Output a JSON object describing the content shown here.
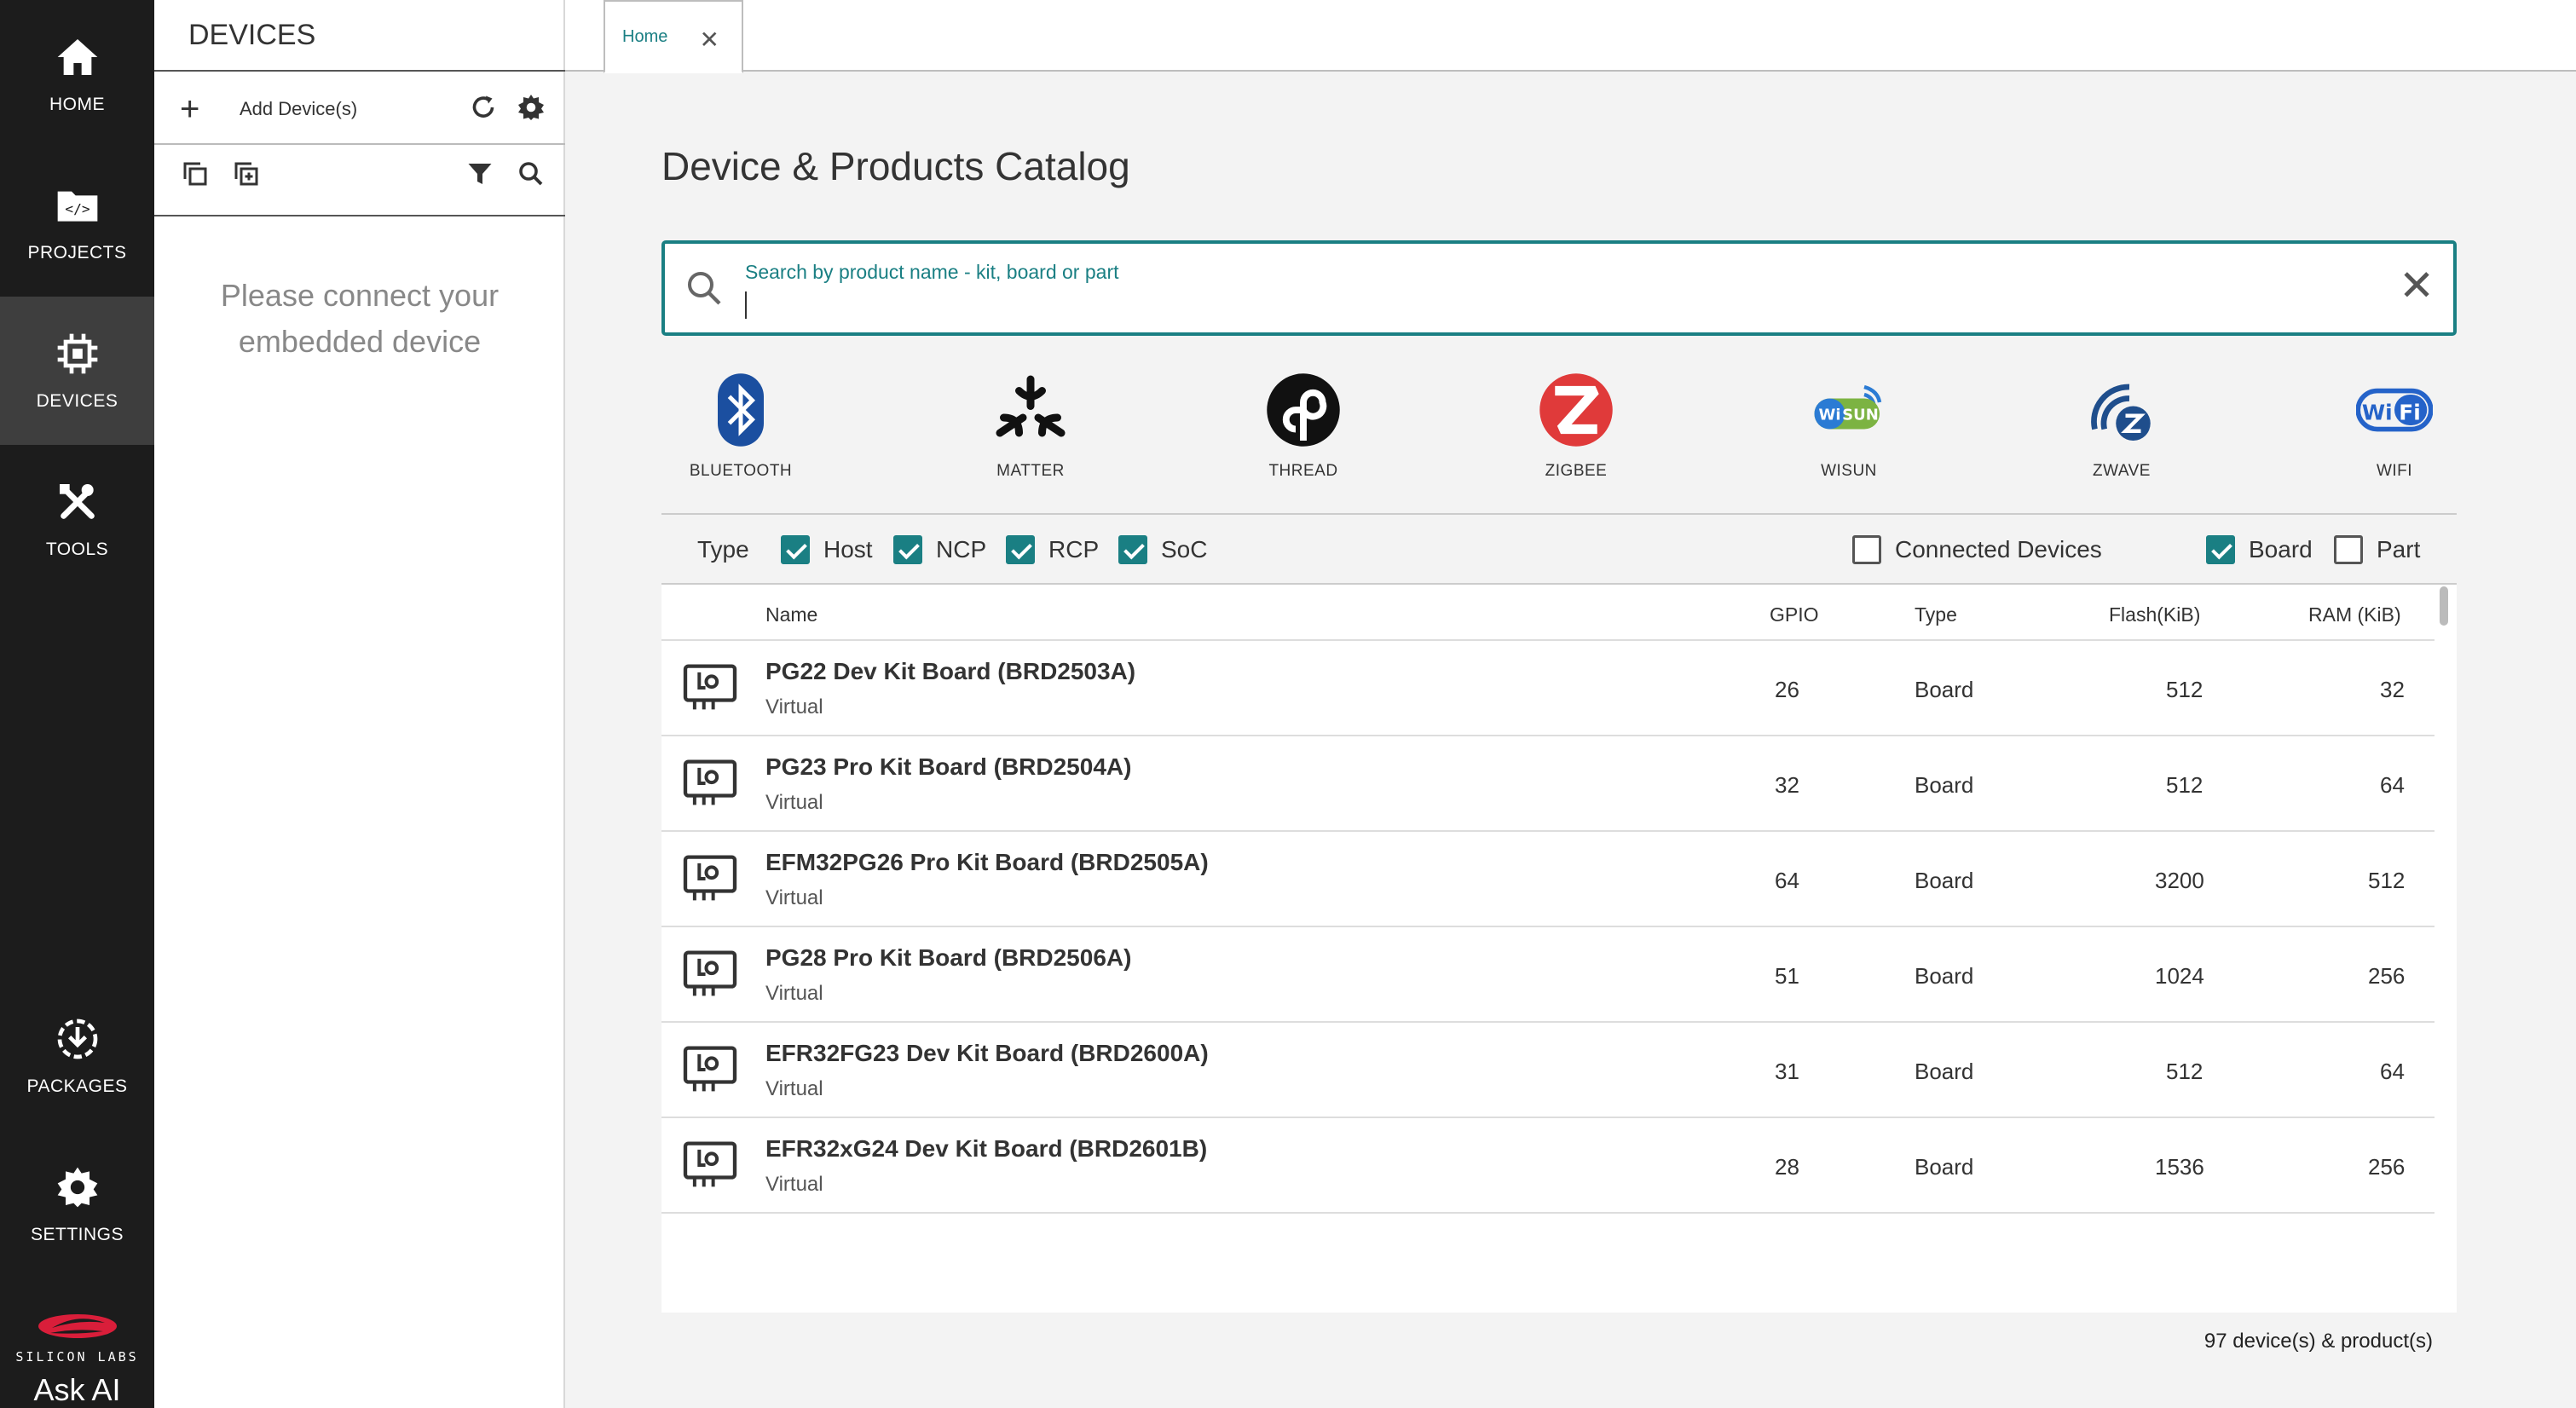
{
  "nav": {
    "home": "HOME",
    "projects": "PROJECTS",
    "devices": "DEVICES",
    "tools": "TOOLS",
    "packages": "PACKAGES",
    "settings": "SETTINGS",
    "logo_text": "SILICON LABS",
    "ask_ai": "Ask AI"
  },
  "devices_panel": {
    "title": "DEVICES",
    "add_label": "Add Device(s)",
    "empty_message": "Please connect your embedded device"
  },
  "tabs": [
    {
      "label": "Home"
    }
  ],
  "main": {
    "title": "Device & Products Catalog",
    "search_placeholder": "Search by product name - kit, board or part",
    "protocols": [
      "BLUETOOTH",
      "MATTER",
      "THREAD",
      "ZIGBEE",
      "WISUN",
      "ZWAVE",
      "WIFI"
    ],
    "filters": {
      "type_label": "Type",
      "host": "Host",
      "ncp": "NCP",
      "rcp": "RCP",
      "soc": "SoC",
      "connected": "Connected Devices",
      "board": "Board",
      "part": "Part"
    },
    "columns": {
      "name": "Name",
      "gpio": "GPIO",
      "type": "Type",
      "flash": "Flash(KiB)",
      "ram": "RAM (KiB)"
    },
    "rows": [
      {
        "name": "PG22 Dev Kit Board (BRD2503A)",
        "sub": "Virtual",
        "gpio": "26",
        "type": "Board",
        "flash": "512",
        "ram": "32"
      },
      {
        "name": "PG23 Pro Kit Board (BRD2504A)",
        "sub": "Virtual",
        "gpio": "32",
        "type": "Board",
        "flash": "512",
        "ram": "64"
      },
      {
        "name": "EFM32PG26 Pro Kit Board (BRD2505A)",
        "sub": "Virtual",
        "gpio": "64",
        "type": "Board",
        "flash": "3200",
        "ram": "512"
      },
      {
        "name": "PG28 Pro Kit Board (BRD2506A)",
        "sub": "Virtual",
        "gpio": "51",
        "type": "Board",
        "flash": "1024",
        "ram": "256"
      },
      {
        "name": "EFR32FG23 Dev Kit Board (BRD2600A)",
        "sub": "Virtual",
        "gpio": "31",
        "type": "Board",
        "flash": "512",
        "ram": "64"
      },
      {
        "name": "EFR32xG24 Dev Kit Board (BRD2601B)",
        "sub": "Virtual",
        "gpio": "28",
        "type": "Board",
        "flash": "1536",
        "ram": "256"
      }
    ],
    "count": "97 device(s) & product(s)"
  },
  "colors": {
    "accent": "#1a7f83",
    "nav_bg": "#1c1c1c",
    "logo_red": "#d91e3a"
  }
}
